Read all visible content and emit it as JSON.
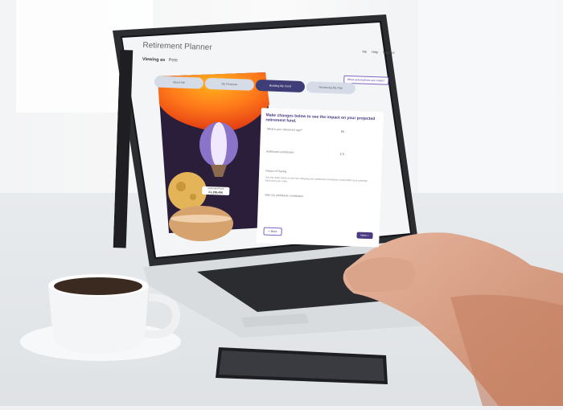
{
  "app": {
    "title": "Retirement Planner"
  },
  "header": {
    "links": [
      "Me",
      "Help",
      "Log Out"
    ]
  },
  "viewing": {
    "label": "Viewing as",
    "name": "Pete"
  },
  "what_if_button": "What assumptions are made?",
  "steps": [
    {
      "label": "About Me",
      "active": false
    },
    {
      "label": "My Finances",
      "active": false
    },
    {
      "label": "Building My Fund",
      "active": true
    },
    {
      "label": "Reviewing My Plan",
      "active": false
    }
  ],
  "panel": {
    "heading": "Make changes below to see the impact on your projected retirement fund.",
    "age_question": "What's your retirement age?",
    "age_value": "65",
    "extra_contribution_label": "Additional contribution",
    "extra_contribution_value": "£ 0",
    "impact_title": "Impact of Saving",
    "impact_text": "Use the slider below to see how delaying your additional contribution would affect your potential fund when you retire.",
    "start_label": "Start my additional contribution",
    "back_button": "< Back",
    "next_button": "Next >"
  },
  "fund": {
    "label": "Estimated fund",
    "value": "£1,198,406"
  },
  "colors": {
    "accent": "#4a3a82",
    "sidebar": "#1f1f23",
    "step_active": "#3f3d78"
  }
}
